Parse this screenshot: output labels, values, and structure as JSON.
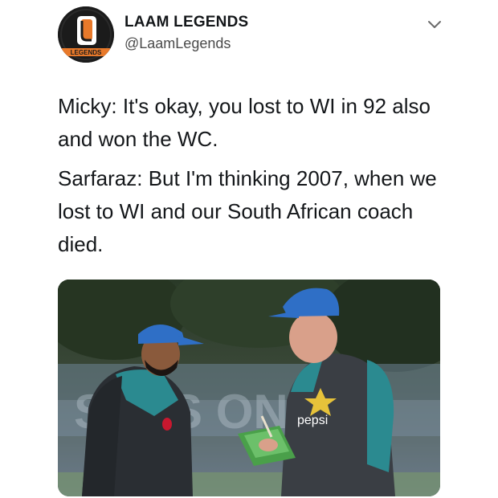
{
  "header": {
    "display_name": "LAAM LEGENDS",
    "handle": "@LaamLegends",
    "avatar_logo_text": "LEGENDS",
    "avatar_icon": "laam-legends-logo",
    "menu_icon": "chevron-down-icon"
  },
  "tweet": {
    "paragraphs": [
      "Micky: It's okay, you lost to WI in 92 also and won the WC.",
      "Sarfaraz: But I'm thinking 2007, when we lost to WI and our South African coach died."
    ]
  },
  "photo": {
    "shirt_sponsor_text": "pepsi"
  },
  "colors": {
    "brand_orange": "#e8792a",
    "cap_blue": "#2f6fc6",
    "jersey_teal": "#2b8a90"
  }
}
